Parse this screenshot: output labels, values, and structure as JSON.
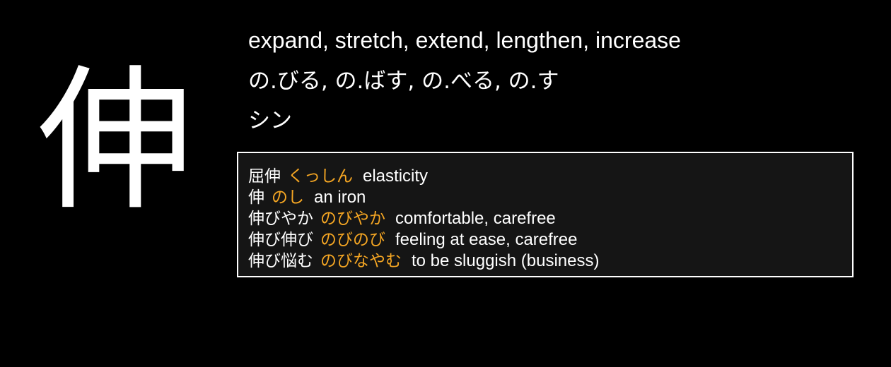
{
  "kanji": "伸",
  "meanings": "expand, stretch, extend, lengthen, increase",
  "kun_readings": "の.びる, の.ばす, の.べる, の.す",
  "on_readings": "シン",
  "examples": [
    {
      "word": "屈伸",
      "reading": "くっしん",
      "meaning": "elasticity"
    },
    {
      "word": "伸",
      "reading": "のし",
      "meaning": "an iron"
    },
    {
      "word": "伸びやか",
      "reading": "のびやか",
      "meaning": "comfortable, carefree"
    },
    {
      "word": "伸び伸び",
      "reading": "のびのび",
      "meaning": "feeling at ease, carefree"
    },
    {
      "word": "伸び悩む",
      "reading": "のびなやむ",
      "meaning": "to be sluggish (business)"
    }
  ],
  "colors": {
    "background": "#000000",
    "text": "#ffffff",
    "reading": "#f5a623",
    "box_background": "#151515"
  }
}
